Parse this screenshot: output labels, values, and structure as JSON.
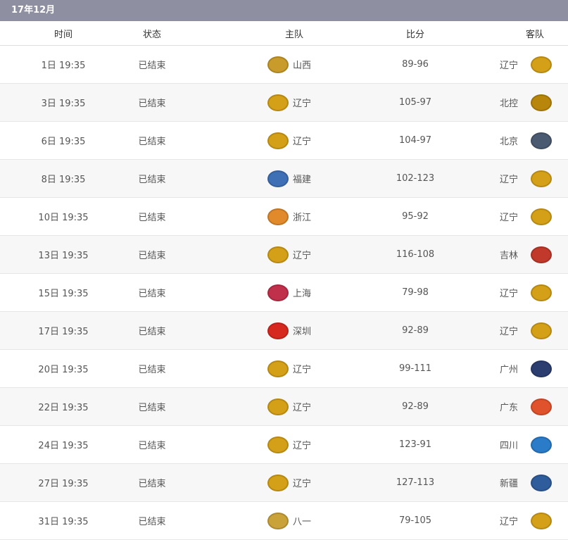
{
  "month_label": "17年12月",
  "columns": {
    "time": "时间",
    "status": "状态",
    "home": "主队",
    "score": "比分",
    "away": "客队"
  },
  "team_colors": {
    "辽宁": "#d4a017",
    "山西": "#c89b2a",
    "北控": "#b8860b",
    "北京": "#4a5a70",
    "福建": "#3f6fb5",
    "浙江": "#e08a2c",
    "吉林": "#c0392b",
    "上海": "#c0304a",
    "深圳": "#d6281f",
    "广州": "#2c3e70",
    "广东": "#e0522c",
    "四川": "#2a7bc8",
    "新疆": "#2f5d9c",
    "八一": "#c9a23a"
  },
  "team_icons": {
    "辽宁": "leopard-logo-icon",
    "山西": "dragon-logo-icon",
    "北控": "lion-logo-icon",
    "北京": "duck-logo-icon",
    "福建": "sturgeon-logo-icon",
    "浙江": "lion-logo-icon",
    "吉林": "tiger-logo-icon",
    "上海": "shark-logo-icon",
    "深圳": "leopard-logo-icon",
    "广州": "dragon-lion-logo-icon",
    "广东": "tiger-logo-icon",
    "四川": "blue-whale-logo-icon",
    "新疆": "flying-tiger-logo-icon",
    "八一": "rocket-logo-icon"
  },
  "games": [
    {
      "time": "1日 19:35",
      "status": "已结束",
      "home": "山西",
      "score": "89-96",
      "away": "辽宁"
    },
    {
      "time": "3日 19:35",
      "status": "已结束",
      "home": "辽宁",
      "score": "105-97",
      "away": "北控"
    },
    {
      "time": "6日 19:35",
      "status": "已结束",
      "home": "辽宁",
      "score": "104-97",
      "away": "北京"
    },
    {
      "time": "8日 19:35",
      "status": "已结束",
      "home": "福建",
      "score": "102-123",
      "away": "辽宁"
    },
    {
      "time": "10日 19:35",
      "status": "已结束",
      "home": "浙江",
      "score": "95-92",
      "away": "辽宁"
    },
    {
      "time": "13日 19:35",
      "status": "已结束",
      "home": "辽宁",
      "score": "116-108",
      "away": "吉林"
    },
    {
      "time": "15日 19:35",
      "status": "已结束",
      "home": "上海",
      "score": "79-98",
      "away": "辽宁"
    },
    {
      "time": "17日 19:35",
      "status": "已结束",
      "home": "深圳",
      "score": "92-89",
      "away": "辽宁"
    },
    {
      "time": "20日 19:35",
      "status": "已结束",
      "home": "辽宁",
      "score": "99-111",
      "away": "广州"
    },
    {
      "time": "22日 19:35",
      "status": "已结束",
      "home": "辽宁",
      "score": "92-89",
      "away": "广东"
    },
    {
      "time": "24日 19:35",
      "status": "已结束",
      "home": "辽宁",
      "score": "123-91",
      "away": "四川"
    },
    {
      "time": "27日 19:35",
      "status": "已结束",
      "home": "辽宁",
      "score": "127-113",
      "away": "新疆"
    },
    {
      "time": "31日 19:35",
      "status": "已结束",
      "home": "八一",
      "score": "79-105",
      "away": "辽宁"
    }
  ]
}
